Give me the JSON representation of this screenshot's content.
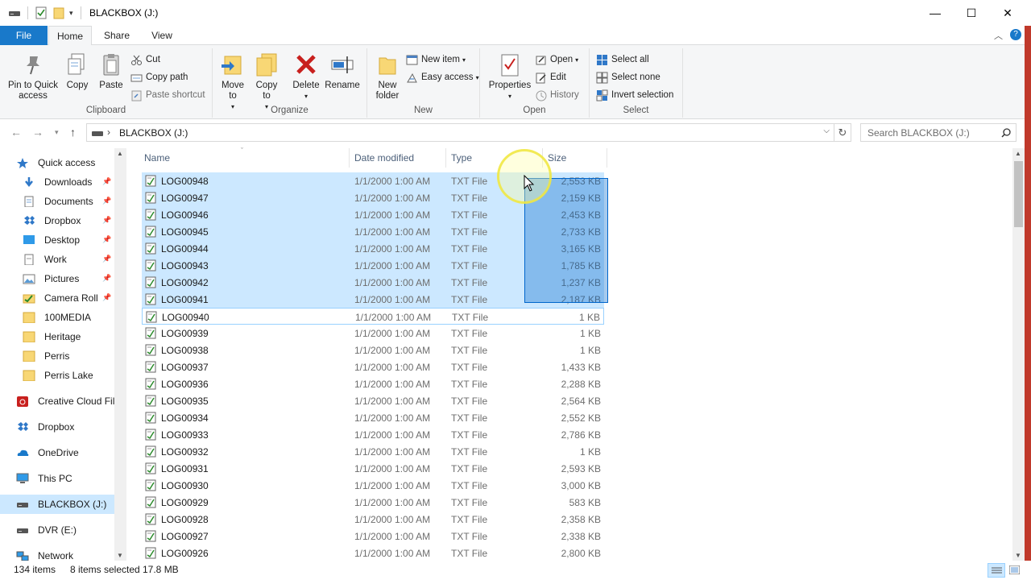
{
  "window": {
    "title": "BLACKBOX (J:)",
    "controls": {
      "minimize": "—",
      "maximize": "☐",
      "close": "✕"
    }
  },
  "tabs": {
    "file": "File",
    "home": "Home",
    "share": "Share",
    "view": "View"
  },
  "ribbon": {
    "clipboard": {
      "label": "Clipboard",
      "pin": "Pin to Quick access",
      "copy": "Copy",
      "paste": "Paste",
      "cut": "Cut",
      "copy_path": "Copy path",
      "paste_shortcut": "Paste shortcut"
    },
    "organize": {
      "label": "Organize",
      "move_to": "Move to",
      "copy_to": "Copy to",
      "delete": "Delete",
      "rename": "Rename"
    },
    "new": {
      "label": "New",
      "new_folder": "New folder",
      "new_item": "New item",
      "easy_access": "Easy access"
    },
    "open": {
      "label": "Open",
      "properties": "Properties",
      "open": "Open",
      "edit": "Edit",
      "history": "History"
    },
    "select": {
      "label": "Select",
      "select_all": "Select all",
      "select_none": "Select none",
      "invert": "Invert selection"
    }
  },
  "address": {
    "path": "BLACKBOX (J:)",
    "search_placeholder": "Search BLACKBOX (J:)"
  },
  "nav": [
    {
      "label": "Quick access",
      "icon": "star-icon",
      "pinned": false
    },
    {
      "label": "Downloads",
      "icon": "download-icon",
      "pinned": true
    },
    {
      "label": "Documents",
      "icon": "documents-icon",
      "pinned": true
    },
    {
      "label": "Dropbox",
      "icon": "dropbox-icon",
      "pinned": true
    },
    {
      "label": "Desktop",
      "icon": "desktop-icon",
      "pinned": true
    },
    {
      "label": "Work",
      "icon": "doc-icon",
      "pinned": true
    },
    {
      "label": "Pictures",
      "icon": "pictures-icon",
      "pinned": true
    },
    {
      "label": "Camera Roll",
      "icon": "camera-roll-icon",
      "pinned": true
    },
    {
      "label": "100MEDIA",
      "icon": "folder-icon",
      "pinned": false
    },
    {
      "label": "Heritage",
      "icon": "folder-icon",
      "pinned": false
    },
    {
      "label": "Perris",
      "icon": "folder-icon",
      "pinned": false
    },
    {
      "label": "Perris Lake",
      "icon": "folder-icon",
      "pinned": false
    },
    {
      "label": "Creative Cloud Fil",
      "icon": "creative-cloud-icon",
      "pinned": false
    },
    {
      "label": "Dropbox",
      "icon": "dropbox-icon",
      "pinned": false
    },
    {
      "label": "OneDrive",
      "icon": "onedrive-icon",
      "pinned": false
    },
    {
      "label": "This PC",
      "icon": "pc-icon",
      "pinned": false
    },
    {
      "label": "BLACKBOX (J:)",
      "icon": "drive-icon",
      "pinned": false
    },
    {
      "label": "DVR (E:)",
      "icon": "drive-icon",
      "pinned": false
    },
    {
      "label": "Network",
      "icon": "network-icon",
      "pinned": false
    }
  ],
  "columns": {
    "name": "Name",
    "date": "Date modified",
    "type": "Type",
    "size": "Size"
  },
  "files": [
    {
      "name": "LOG00948",
      "date": "1/1/2000 1:00 AM",
      "type": "TXT File",
      "size": "2,553 KB",
      "selected": true
    },
    {
      "name": "LOG00947",
      "date": "1/1/2000 1:00 AM",
      "type": "TXT File",
      "size": "2,159 KB",
      "selected": true
    },
    {
      "name": "LOG00946",
      "date": "1/1/2000 1:00 AM",
      "type": "TXT File",
      "size": "2,453 KB",
      "selected": true
    },
    {
      "name": "LOG00945",
      "date": "1/1/2000 1:00 AM",
      "type": "TXT File",
      "size": "2,733 KB",
      "selected": true
    },
    {
      "name": "LOG00944",
      "date": "1/1/2000 1:00 AM",
      "type": "TXT File",
      "size": "3,165 KB",
      "selected": true
    },
    {
      "name": "LOG00943",
      "date": "1/1/2000 1:00 AM",
      "type": "TXT File",
      "size": "1,785 KB",
      "selected": true
    },
    {
      "name": "LOG00942",
      "date": "1/1/2000 1:00 AM",
      "type": "TXT File",
      "size": "1,237 KB",
      "selected": true
    },
    {
      "name": "LOG00941",
      "date": "1/1/2000 1:00 AM",
      "type": "TXT File",
      "size": "2,187 KB",
      "selected": true
    },
    {
      "name": "LOG00940",
      "date": "1/1/2000 1:00 AM",
      "type": "TXT File",
      "size": "1 KB",
      "selected": false,
      "focused": true
    },
    {
      "name": "LOG00939",
      "date": "1/1/2000 1:00 AM",
      "type": "TXT File",
      "size": "1 KB",
      "selected": false
    },
    {
      "name": "LOG00938",
      "date": "1/1/2000 1:00 AM",
      "type": "TXT File",
      "size": "1 KB",
      "selected": false
    },
    {
      "name": "LOG00937",
      "date": "1/1/2000 1:00 AM",
      "type": "TXT File",
      "size": "1,433 KB",
      "selected": false
    },
    {
      "name": "LOG00936",
      "date": "1/1/2000 1:00 AM",
      "type": "TXT File",
      "size": "2,288 KB",
      "selected": false
    },
    {
      "name": "LOG00935",
      "date": "1/1/2000 1:00 AM",
      "type": "TXT File",
      "size": "2,564 KB",
      "selected": false
    },
    {
      "name": "LOG00934",
      "date": "1/1/2000 1:00 AM",
      "type": "TXT File",
      "size": "2,552 KB",
      "selected": false
    },
    {
      "name": "LOG00933",
      "date": "1/1/2000 1:00 AM",
      "type": "TXT File",
      "size": "2,786 KB",
      "selected": false
    },
    {
      "name": "LOG00932",
      "date": "1/1/2000 1:00 AM",
      "type": "TXT File",
      "size": "1 KB",
      "selected": false
    },
    {
      "name": "LOG00931",
      "date": "1/1/2000 1:00 AM",
      "type": "TXT File",
      "size": "2,593 KB",
      "selected": false
    },
    {
      "name": "LOG00930",
      "date": "1/1/2000 1:00 AM",
      "type": "TXT File",
      "size": "3,000 KB",
      "selected": false
    },
    {
      "name": "LOG00929",
      "date": "1/1/2000 1:00 AM",
      "type": "TXT File",
      "size": "583 KB",
      "selected": false
    },
    {
      "name": "LOG00928",
      "date": "1/1/2000 1:00 AM",
      "type": "TXT File",
      "size": "2,358 KB",
      "selected": false
    },
    {
      "name": "LOG00927",
      "date": "1/1/2000 1:00 AM",
      "type": "TXT File",
      "size": "2,338 KB",
      "selected": false
    },
    {
      "name": "LOG00926",
      "date": "1/1/2000 1:00 AM",
      "type": "TXT File",
      "size": "2,800 KB",
      "selected": false
    }
  ],
  "status": {
    "items": "134 items",
    "selected": "8 items selected",
    "size": "17.8 MB"
  },
  "colors": {
    "accent": "#1979ca",
    "selection": "#cce8ff",
    "marquee": "#0066cc",
    "folder": "#f8d775"
  }
}
